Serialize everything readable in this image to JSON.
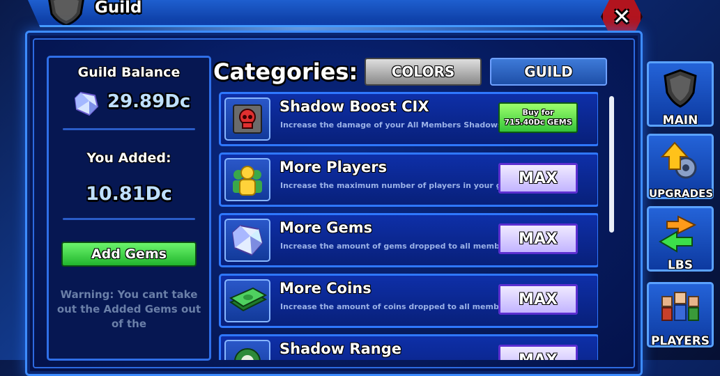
{
  "window": {
    "title": "Guild",
    "close_label": "✕"
  },
  "left_panel": {
    "balance_label": "Guild Balance",
    "balance_value": "29.89Dc",
    "added_label": "You Added:",
    "added_value": "10.81Dc",
    "add_gems_label": "Add Gems",
    "warning_text": "Warning: You cant take out the Added Gems out of the"
  },
  "categories": {
    "title": "Categories:",
    "tabs": [
      {
        "label": "COLORS"
      },
      {
        "label": "GUILD"
      }
    ]
  },
  "upgrades": [
    {
      "title": "Shadow Boost CIX",
      "desc": "Increase the damage of your All Members Shadows.",
      "icon": "skull-icon",
      "action": "buy",
      "buy_line1": "Buy for",
      "buy_line2": "715.40Dc GEMS"
    },
    {
      "title": "More Players",
      "desc": "Increase the maximum number of players in your guild.",
      "icon": "players-icon",
      "action": "max",
      "button_label": "MAX"
    },
    {
      "title": "More Gems",
      "desc": "Increase the amount of gems dropped to all members.",
      "icon": "gem-icon",
      "action": "max",
      "button_label": "MAX"
    },
    {
      "title": "More Coins",
      "desc": "Increase the amount of coins dropped to all members.",
      "icon": "cash-icon",
      "action": "max",
      "button_label": "MAX"
    },
    {
      "title": "Shadow Range",
      "desc": "",
      "icon": "shadow-range-icon",
      "action": "max",
      "button_label": "MAX"
    }
  ],
  "sidebar": [
    {
      "label": "MAIN",
      "icon": "shield-icon"
    },
    {
      "label": "UPGRADES",
      "icon": "upgrade-arrow-icon"
    },
    {
      "label": "LBS",
      "icon": "swap-arrows-icon"
    },
    {
      "label": "PLAYERS",
      "icon": "players-group-icon"
    }
  ],
  "colors": {
    "accent": "#2f78ff",
    "green": "#35c43a",
    "max_purple": "#5c2fd0",
    "close_red": "#b2141e"
  }
}
